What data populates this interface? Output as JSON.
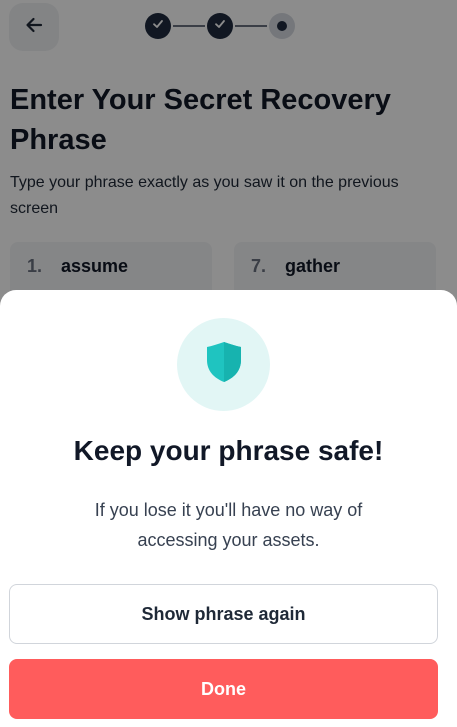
{
  "header": {
    "back_icon": "arrow-left-icon",
    "stepper": {
      "total_steps": 3,
      "completed_steps": 2,
      "current_step": 3
    }
  },
  "page": {
    "title": "Enter Your Secret Recovery Phrase",
    "subtitle": "Type your phrase exactly as you saw it on the previous screen"
  },
  "words": [
    {
      "index": "1.",
      "word": "assume"
    },
    {
      "index": "7.",
      "word": "gather"
    }
  ],
  "sheet": {
    "icon": "shield-icon",
    "title": "Keep your phrase safe!",
    "message": "If you lose it you'll have no way of accessing your assets.",
    "secondary_button": "Show phrase again",
    "primary_button": "Done"
  },
  "colors": {
    "primary": "#ff5c5c",
    "shield": "#1fc4c0",
    "shield_bg": "#e2f6f5",
    "stepper_active": "#1f2b3f"
  }
}
